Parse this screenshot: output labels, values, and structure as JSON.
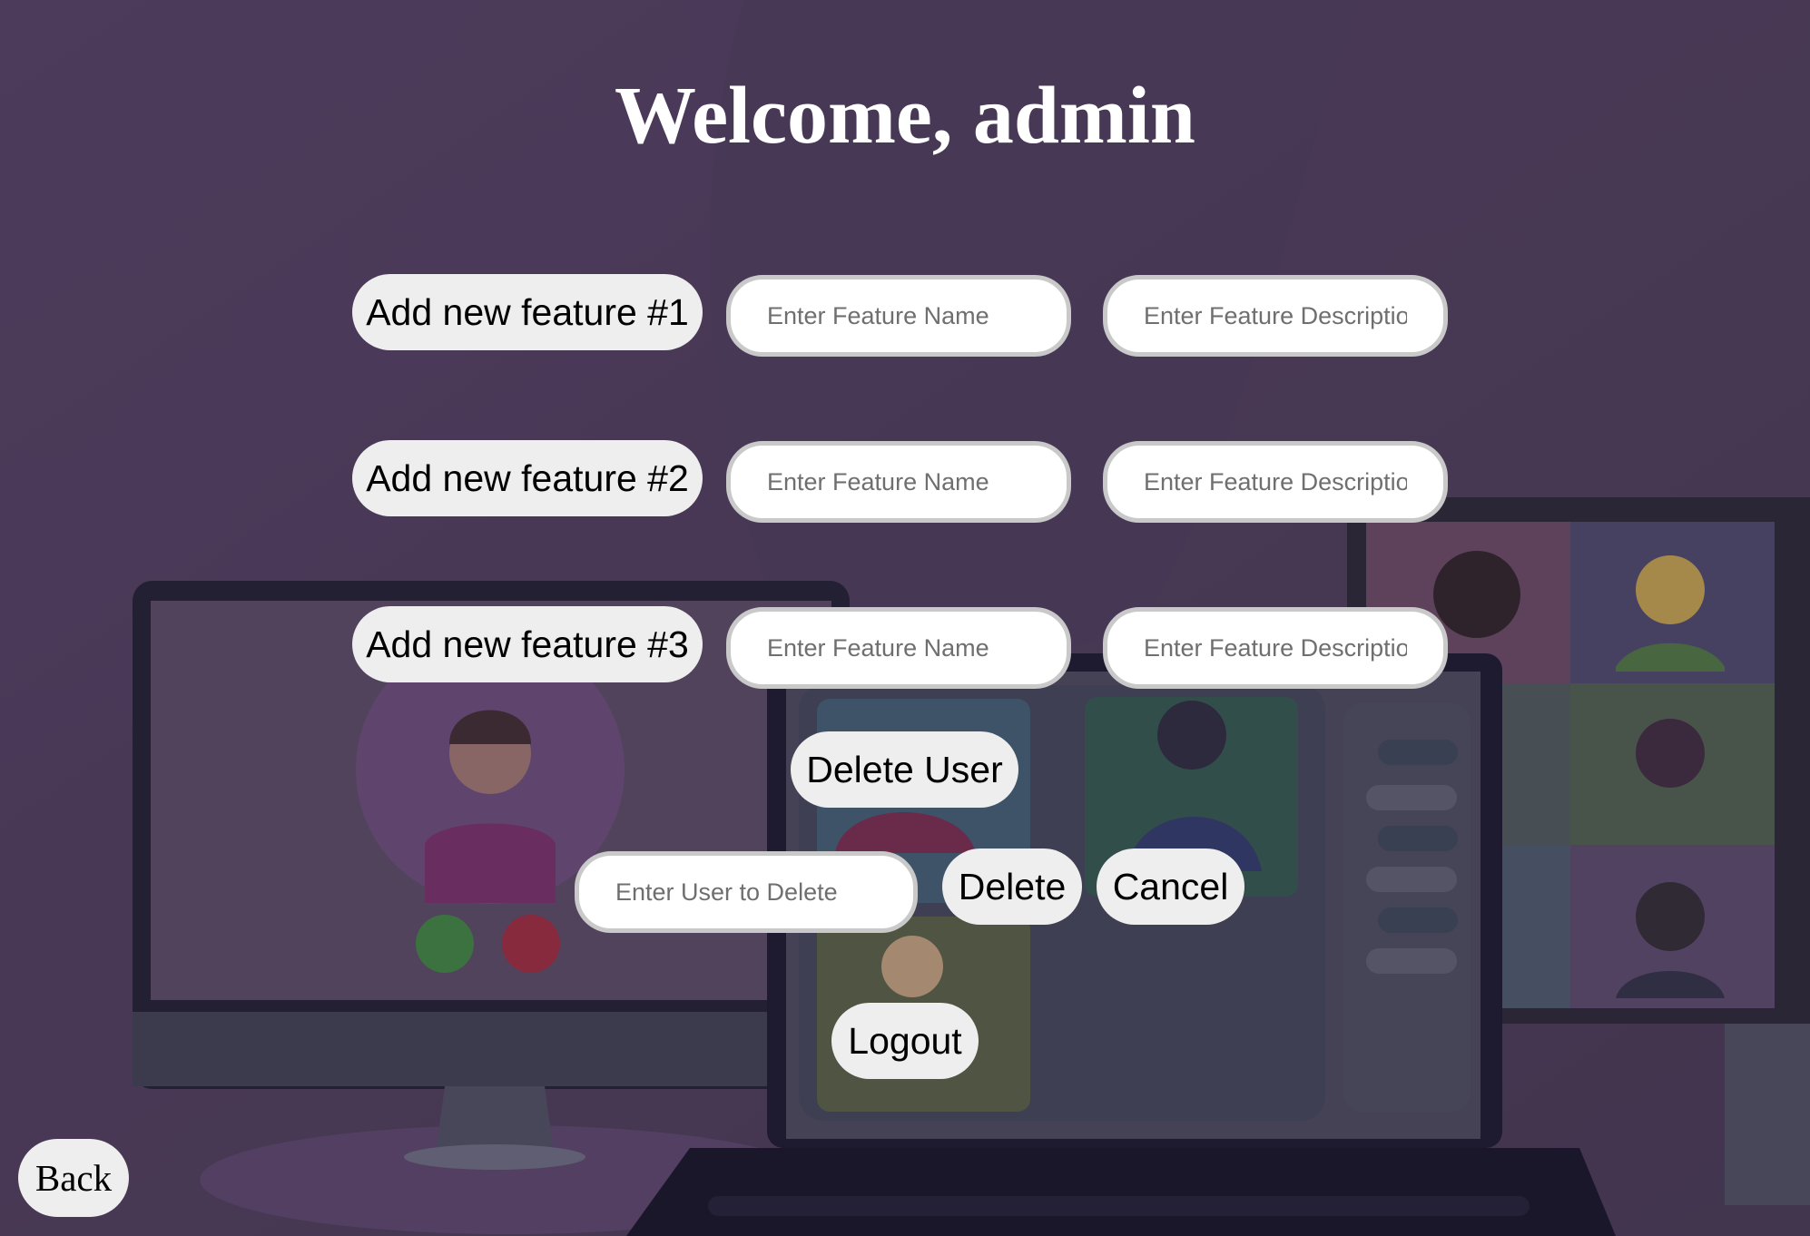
{
  "page": {
    "heading": "Welcome, admin"
  },
  "features": [
    {
      "button_label": "Add new feature #1",
      "name_placeholder": "Enter Feature Name",
      "desc_placeholder": "Enter Feature Descriptio"
    },
    {
      "button_label": "Add new feature #2",
      "name_placeholder": "Enter Feature Name",
      "desc_placeholder": "Enter Feature Descriptio"
    },
    {
      "button_label": "Add new feature #3",
      "name_placeholder": "Enter Feature Name",
      "desc_placeholder": "Enter Feature Descriptio"
    }
  ],
  "delete_user": {
    "toggle_label": "Delete User",
    "input_placeholder": "Enter User to Delete",
    "delete_label": "Delete",
    "cancel_label": "Cancel"
  },
  "logout_label": "Logout",
  "back_label": "Back",
  "colors": {
    "background": "#4f3d5c",
    "button_bg": "#eeeeee",
    "input_border": "#c9c9c9",
    "heading_text": "#ffffff"
  }
}
